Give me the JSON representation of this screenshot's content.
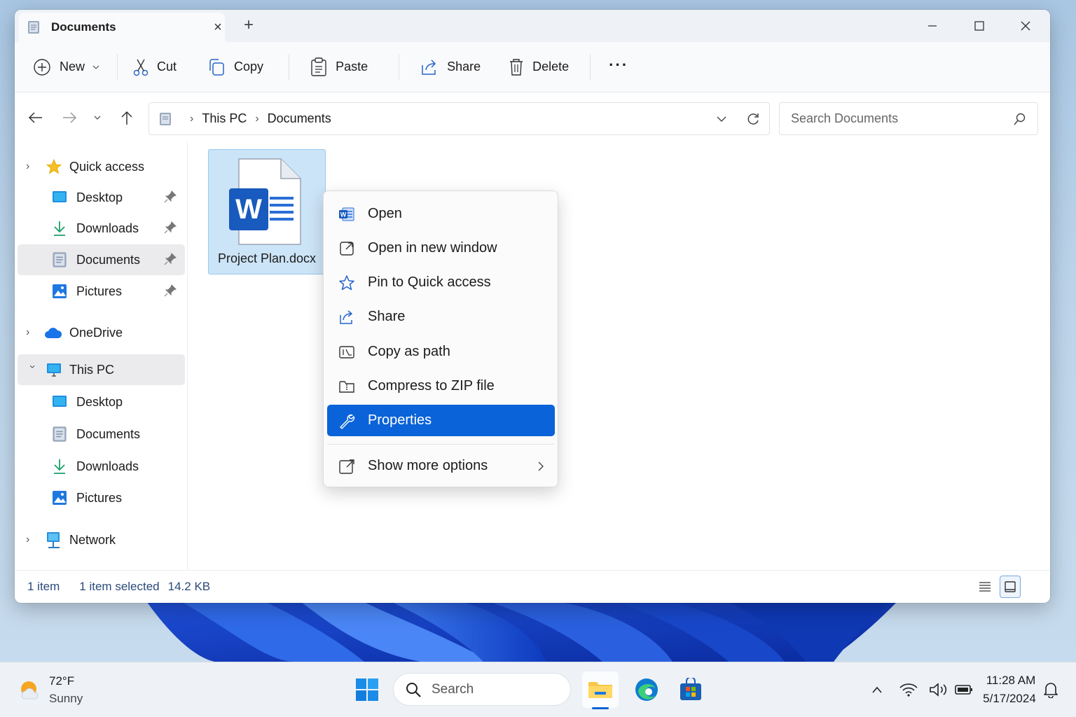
{
  "window": {
    "tab_title": "Documents",
    "new_tab_symbol": "+",
    "tab_close_symbol": "×"
  },
  "toolbar": {
    "new_label": "New",
    "cut_label": "Cut",
    "copy_label": "Copy",
    "paste_label": "Paste",
    "share_label": "Share",
    "delete_label": "Delete",
    "more_label": "···"
  },
  "address": {
    "crumbs": [
      "This PC",
      "Documents"
    ],
    "search_placeholder": "Search Documents"
  },
  "sidebar": {
    "quick_access": "Quick access",
    "quick_items": [
      "Desktop",
      "Downloads",
      "Documents",
      "Pictures"
    ],
    "onedrive": "OneDrive",
    "this_pc": "This PC",
    "pc_items": [
      "Desktop",
      "Documents",
      "Downloads",
      "Pictures"
    ],
    "network": "Network"
  },
  "files": [
    {
      "name": "Project Plan.docx",
      "icon": "word-document-icon",
      "selected": true
    }
  ],
  "context_menu": {
    "items": [
      {
        "label": "Open",
        "icon": "word-icon"
      },
      {
        "label": "Open in new window",
        "icon": "open-external-icon"
      },
      {
        "label": "Pin to Quick access",
        "icon": "star-icon"
      },
      {
        "label": "Share",
        "icon": "share-icon"
      },
      {
        "label": "Copy as path",
        "icon": "copy-path-icon"
      },
      {
        "label": "Compress to ZIP file",
        "icon": "zip-icon"
      },
      {
        "label": "Properties",
        "icon": "wrench-icon",
        "highlighted": true
      },
      {
        "label": "Show more options",
        "icon": "more-options-icon"
      }
    ]
  },
  "status": {
    "count": "1 item",
    "selected": "1 item selected",
    "size": "14.2 KB"
  },
  "taskbar": {
    "temperature": "72°F",
    "weather": "Sunny",
    "search_label": "Search",
    "time": "11:28 AM",
    "date": "5/17/2024"
  },
  "colors": {
    "accent": "#0a63d8",
    "selection_bg": "#cce4f7",
    "word_blue": "#185abd"
  }
}
